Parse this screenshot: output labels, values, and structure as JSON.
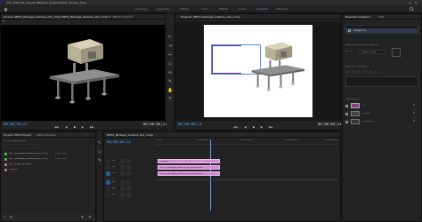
{
  "menu": {
    "items": [
      "File",
      "Edit",
      "Clip",
      "Sequence",
      "Markers",
      "Graphics",
      "View",
      "Window",
      "Help"
    ]
  },
  "workspaces": {
    "items": [
      "Learning",
      "Assembly",
      "Editing",
      "Color",
      "Effects",
      "Audio",
      "Graphics",
      "Libraries"
    ],
    "active": "Graphics"
  },
  "source_monitor": {
    "tabs": [
      "Source: MP72_Package_Gobline_v01_comp MP72_Package_Gobline_v01_comp 00:00:00:00",
      "Effect Controls"
    ],
    "timecode_left": "00;00;04;23",
    "timecode_right": "00;00;04;23",
    "zoom": "Fit"
  },
  "program_monitor": {
    "tab": "Program: MP72_Package_Gobline_v02_comp",
    "timecode_left": "00;00;04;23",
    "timecode_right": "00;00;04;23",
    "zoom": "Fit",
    "quality": "Full"
  },
  "essential_graphics": {
    "tabs": [
      "Essential Graphics",
      "Edit"
    ],
    "layer": "Shape 01",
    "sections": {
      "responsive": "Responsive Design - Position",
      "pin_to": "Pin To:",
      "pin_value": "Video Frame",
      "align": "Align and Transform",
      "appearance": "Appearance",
      "fill_label": "Fill",
      "stroke_label": "Stroke",
      "shadow_label": "Shadow"
    },
    "fill_color": "#8d3b8d"
  },
  "project": {
    "tabs": [
      "Project: MP7s Project",
      "Media Browser"
    ],
    "name": "MP7s Project.prproj",
    "items": [
      {
        "name": "MP7_Package_Gobline_v01_comp",
        "meta": "29.97 fps",
        "color": "#4caf50"
      },
      {
        "name": "MP7_Package_Gobline_v02_comp",
        "meta": "29.97 fps",
        "color": "#4caf50"
      },
      {
        "name": "MP7_Logo_v02.png",
        "meta": "",
        "color": "#b06ab0"
      },
      {
        "name": "Title 01",
        "meta": "",
        "color": "#b06ab0"
      }
    ],
    "count": "4 Items"
  },
  "timeline": {
    "tab": "MP72_Package_Gobline_v02_comp",
    "timecode": "00;00;04;23",
    "ruler": [
      "00;00",
      "00;00;02;00",
      "00;00;04;00",
      "00;00;06;00",
      "00;00;08;00"
    ],
    "video_tracks": [
      "V3",
      "V2",
      "V1"
    ],
    "audio_tracks": [
      "A1",
      "A2",
      "A3"
    ],
    "clips": [
      {
        "label": "Graphic",
        "track": "V3"
      },
      {
        "label": "MP72_Package_Gobline_v02_comp.mp4",
        "track": "V2"
      },
      {
        "label": "MP72_Package_Gobline_v01_comp.mp4",
        "track": "V1"
      }
    ],
    "clip_color": "#d28ad2"
  }
}
